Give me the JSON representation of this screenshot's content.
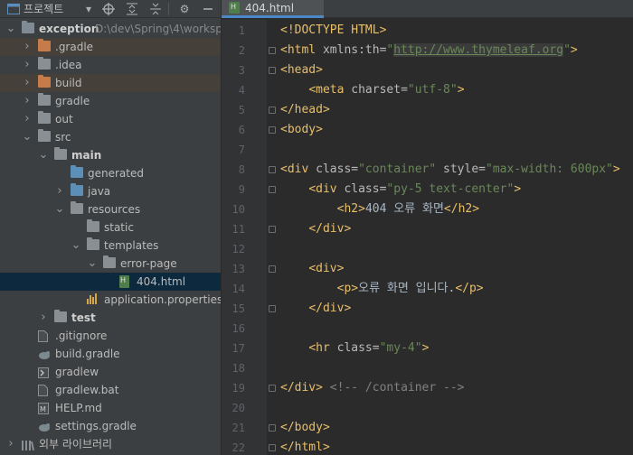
{
  "project_panel": {
    "title": "프로젝트",
    "tree": [
      {
        "label": "exception",
        "path": "D:\\dev\\Spring\\4\\worksp",
        "depth": 0,
        "expanded": true,
        "type": "module",
        "bold": true
      },
      {
        "label": ".gradle",
        "depth": 1,
        "expanded": false,
        "type": "folder-orange",
        "highlight": true
      },
      {
        "label": ".idea",
        "depth": 1,
        "expanded": false,
        "type": "folder"
      },
      {
        "label": "build",
        "depth": 1,
        "expanded": false,
        "type": "folder-orange",
        "highlight": true
      },
      {
        "label": "gradle",
        "depth": 1,
        "expanded": false,
        "type": "folder"
      },
      {
        "label": "out",
        "depth": 1,
        "expanded": false,
        "type": "folder"
      },
      {
        "label": "src",
        "depth": 1,
        "expanded": true,
        "type": "folder"
      },
      {
        "label": "main",
        "depth": 2,
        "expanded": true,
        "type": "folder",
        "bold": true
      },
      {
        "label": "generated",
        "depth": 3,
        "expanded": null,
        "type": "folder-blue"
      },
      {
        "label": "java",
        "depth": 3,
        "expanded": false,
        "type": "folder-blue"
      },
      {
        "label": "resources",
        "depth": 3,
        "expanded": true,
        "type": "folder-res"
      },
      {
        "label": "static",
        "depth": 4,
        "expanded": null,
        "type": "folder"
      },
      {
        "label": "templates",
        "depth": 4,
        "expanded": true,
        "type": "folder"
      },
      {
        "label": "error-page",
        "depth": 5,
        "expanded": true,
        "type": "folder"
      },
      {
        "label": "404.html",
        "depth": 6,
        "expanded": null,
        "type": "file-html",
        "selected": true
      },
      {
        "label": "application.properties",
        "depth": 4,
        "expanded": null,
        "type": "file-props"
      },
      {
        "label": "test",
        "depth": 2,
        "expanded": false,
        "type": "folder",
        "bold": true
      },
      {
        "label": ".gitignore",
        "depth": 1,
        "expanded": null,
        "type": "file"
      },
      {
        "label": "build.gradle",
        "depth": 1,
        "expanded": null,
        "type": "file-gradle"
      },
      {
        "label": "gradlew",
        "depth": 1,
        "expanded": null,
        "type": "file-term"
      },
      {
        "label": "gradlew.bat",
        "depth": 1,
        "expanded": null,
        "type": "file"
      },
      {
        "label": "HELP.md",
        "depth": 1,
        "expanded": null,
        "type": "file-md"
      },
      {
        "label": "settings.gradle",
        "depth": 1,
        "expanded": null,
        "type": "file-gradle"
      },
      {
        "label": "외부 라이브러리",
        "depth": 0,
        "expanded": false,
        "type": "libs"
      }
    ]
  },
  "editor": {
    "tab_label": "404.html",
    "line_numbers": [
      "1",
      "2",
      "3",
      "4",
      "5",
      "6",
      "7",
      "8",
      "9",
      "10",
      "11",
      "12",
      "13",
      "14",
      "15",
      "16",
      "17",
      "18",
      "19",
      "20",
      "21",
      "22"
    ],
    "lines": [
      [
        {
          "t": "tag",
          "s": "<!DOCTYPE HTML>"
        }
      ],
      [
        {
          "t": "tag",
          "s": "<html "
        },
        {
          "t": "attr",
          "s": "xmlns:th="
        },
        {
          "t": "val",
          "s": "\""
        },
        {
          "t": "url",
          "s": "http://www.thymeleaf.org"
        },
        {
          "t": "val",
          "s": "\""
        },
        {
          "t": "tag",
          "s": ">"
        }
      ],
      [
        {
          "t": "tag",
          "s": "<head>"
        }
      ],
      [
        {
          "t": "txt",
          "s": "    "
        },
        {
          "t": "tag",
          "s": "<meta "
        },
        {
          "t": "attr",
          "s": "charset="
        },
        {
          "t": "val",
          "s": "\"utf-8\""
        },
        {
          "t": "tag",
          "s": ">"
        }
      ],
      [
        {
          "t": "tag",
          "s": "</head>"
        }
      ],
      [
        {
          "t": "tag",
          "s": "<body>"
        }
      ],
      [],
      [
        {
          "t": "tag",
          "s": "<div "
        },
        {
          "t": "attr",
          "s": "class="
        },
        {
          "t": "val",
          "s": "\"container\" "
        },
        {
          "t": "attr",
          "s": "style="
        },
        {
          "t": "val",
          "s": "\"max-width: 600px\""
        },
        {
          "t": "tag",
          "s": ">"
        }
      ],
      [
        {
          "t": "txt",
          "s": "    "
        },
        {
          "t": "tag",
          "s": "<div "
        },
        {
          "t": "attr",
          "s": "class="
        },
        {
          "t": "val",
          "s": "\"py-5 text-center\""
        },
        {
          "t": "tag",
          "s": ">"
        }
      ],
      [
        {
          "t": "txt",
          "s": "        "
        },
        {
          "t": "tag",
          "s": "<h2>"
        },
        {
          "t": "txt",
          "s": "404 오류 화면"
        },
        {
          "t": "tag",
          "s": "</h2>"
        }
      ],
      [
        {
          "t": "txt",
          "s": "    "
        },
        {
          "t": "tag",
          "s": "</div>"
        }
      ],
      [],
      [
        {
          "t": "txt",
          "s": "    "
        },
        {
          "t": "tag",
          "s": "<div>"
        }
      ],
      [
        {
          "t": "txt",
          "s": "        "
        },
        {
          "t": "tag",
          "s": "<p>"
        },
        {
          "t": "txt",
          "s": "오류 화면 입니다."
        },
        {
          "t": "tag",
          "s": "</p>"
        }
      ],
      [
        {
          "t": "txt",
          "s": "    "
        },
        {
          "t": "tag",
          "s": "</div>"
        }
      ],
      [],
      [
        {
          "t": "txt",
          "s": "    "
        },
        {
          "t": "tag",
          "s": "<hr "
        },
        {
          "t": "attr",
          "s": "class="
        },
        {
          "t": "val",
          "s": "\"my-4\""
        },
        {
          "t": "tag",
          "s": ">"
        }
      ],
      [],
      [
        {
          "t": "tag",
          "s": "</div>"
        },
        {
          "t": "txt",
          "s": " "
        },
        {
          "t": "cmt",
          "s": "<!-- /container -->"
        }
      ],
      [],
      [
        {
          "t": "tag",
          "s": "</body>"
        }
      ],
      [
        {
          "t": "tag",
          "s": "</html>"
        }
      ]
    ],
    "fold_lines": [
      2,
      3,
      5,
      6,
      8,
      9,
      11,
      13,
      15,
      19,
      21,
      22
    ]
  }
}
